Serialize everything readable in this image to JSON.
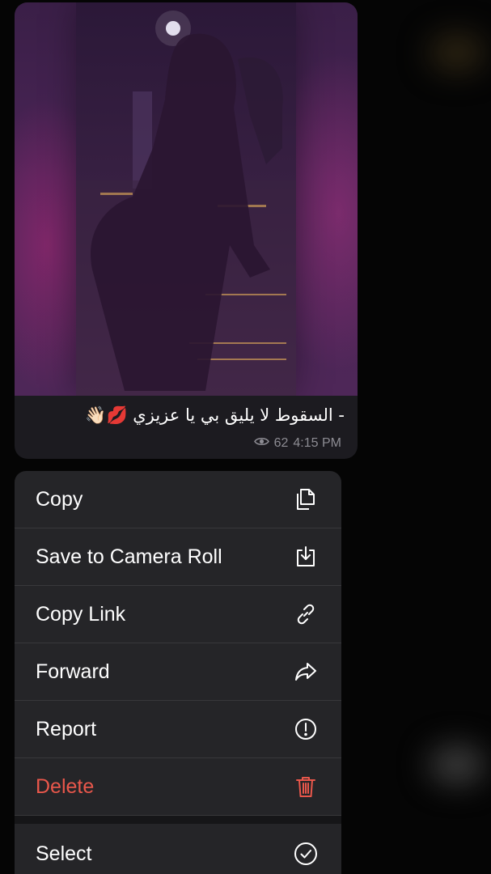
{
  "message": {
    "caption": "- السقوط لا يليق بي يا عزيزي 💋👋🏻",
    "views": "62",
    "time": "4:15 PM"
  },
  "context_menu": {
    "items": [
      {
        "label": "Copy",
        "icon": "copy-icon"
      },
      {
        "label": "Save to Camera Roll",
        "icon": "save-download-icon"
      },
      {
        "label": "Copy Link",
        "icon": "link-icon"
      },
      {
        "label": "Forward",
        "icon": "forward-arrow-icon"
      },
      {
        "label": "Report",
        "icon": "alert-circle-icon"
      },
      {
        "label": "Delete",
        "icon": "trash-icon",
        "color": "#e9574b"
      },
      {
        "label": "Select",
        "icon": "checkmark-circle-icon"
      }
    ]
  }
}
